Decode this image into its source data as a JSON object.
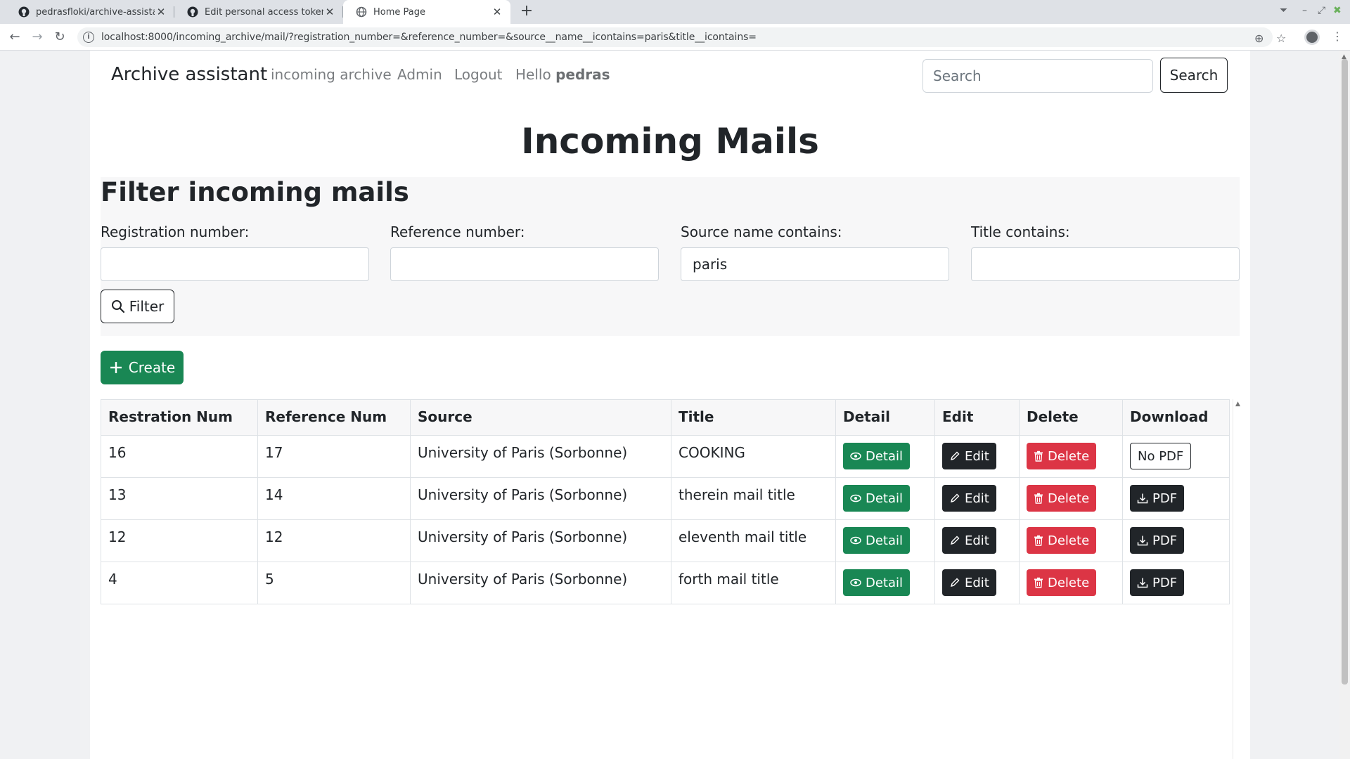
{
  "browser": {
    "tabs": [
      {
        "title": "pedrasfloki/archive-assistant: c",
        "active": false
      },
      {
        "title": "Edit personal access token",
        "active": false
      },
      {
        "title": "Home Page",
        "active": true
      }
    ],
    "url": "localhost:8000/incoming_archive/mail/?registration_number=&reference_number=&source__name__icontains=paris&title__icontains="
  },
  "navbar": {
    "brand": "Archive assistant",
    "links": [
      "incoming archive",
      "Admin",
      "Logout"
    ],
    "greeting": "Hello",
    "username": "pedras",
    "search_placeholder": "Search",
    "search_button": "Search"
  },
  "main": {
    "title": "Incoming Mails"
  },
  "filter": {
    "title": "Filter incoming mails",
    "fields": [
      {
        "label": "Registration number:",
        "value": ""
      },
      {
        "label": "Reference number:",
        "value": ""
      },
      {
        "label": "Source name contains:",
        "value": "paris"
      },
      {
        "label": "Title contains:",
        "value": ""
      }
    ],
    "button": "Filter"
  },
  "create_button": "Create",
  "table": {
    "headers": [
      "Restration Num",
      "Reference Num",
      "Source",
      "Title",
      "Detail",
      "Edit",
      "Delete",
      "Download"
    ],
    "rows": [
      {
        "registration": "16",
        "reference": "17",
        "source": "University of Paris (Sorbonne)",
        "title": "COOKING",
        "detail": "Detail",
        "edit": "Edit",
        "delete": "Delete",
        "download": "No PDF",
        "has_pdf": false
      },
      {
        "registration": "13",
        "reference": "14",
        "source": "University of Paris (Sorbonne)",
        "title": "therein mail title",
        "detail": "Detail",
        "edit": "Edit",
        "delete": "Delete",
        "download": "PDF",
        "has_pdf": true
      },
      {
        "registration": "12",
        "reference": "12",
        "source": "University of Paris (Sorbonne)",
        "title": "eleventh mail title",
        "detail": "Detail",
        "edit": "Edit",
        "delete": "Delete",
        "download": "PDF",
        "has_pdf": true
      },
      {
        "registration": "4",
        "reference": "5",
        "source": "University of Paris (Sorbonne)",
        "title": "forth mail title",
        "detail": "Detail",
        "edit": "Edit",
        "delete": "Delete",
        "download": "PDF",
        "has_pdf": true
      }
    ]
  },
  "colors": {
    "success": "#198754",
    "danger": "#dc3545",
    "dark": "#212529"
  }
}
